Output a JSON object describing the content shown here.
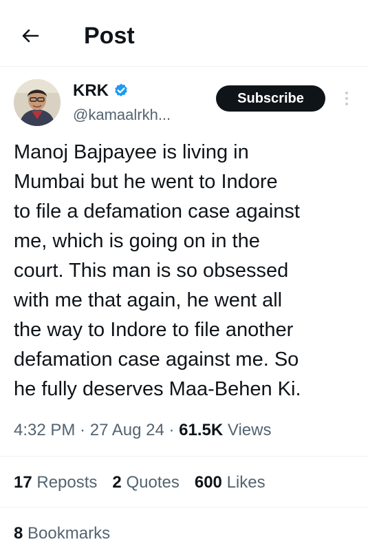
{
  "header": {
    "title": "Post",
    "back_icon": "arrow-left-icon"
  },
  "author": {
    "name": "KRK",
    "handle": "@kamaalrkh...",
    "verified_icon": "verified-badge-icon",
    "verified_color": "#1d9bf0"
  },
  "subscribe_label": "Subscribe",
  "more_icon": "more-vertical-icon",
  "tweet": {
    "lines": [
      "Manoj Bajpayee is living in",
      "Mumbai but he went to Indore",
      "to file a defamation case against",
      "me, which is going on in the",
      "court. This man is so obsessed",
      "with me that again, he went all",
      "the way to Indore to file another",
      "defamation case against me. So",
      "he fully deserves Maa-Behen Ki."
    ]
  },
  "meta": {
    "time": "4:32 PM",
    "separator": " · ",
    "date": "27 Aug 24",
    "views_count": "61.5K",
    "views_label": "Views"
  },
  "stats": {
    "reposts_count": "17",
    "reposts_label": "Reposts",
    "quotes_count": "2",
    "quotes_label": "Quotes",
    "likes_count": "600",
    "likes_label": "Likes"
  },
  "bookmarks": {
    "count": "8",
    "label": "Bookmarks"
  }
}
